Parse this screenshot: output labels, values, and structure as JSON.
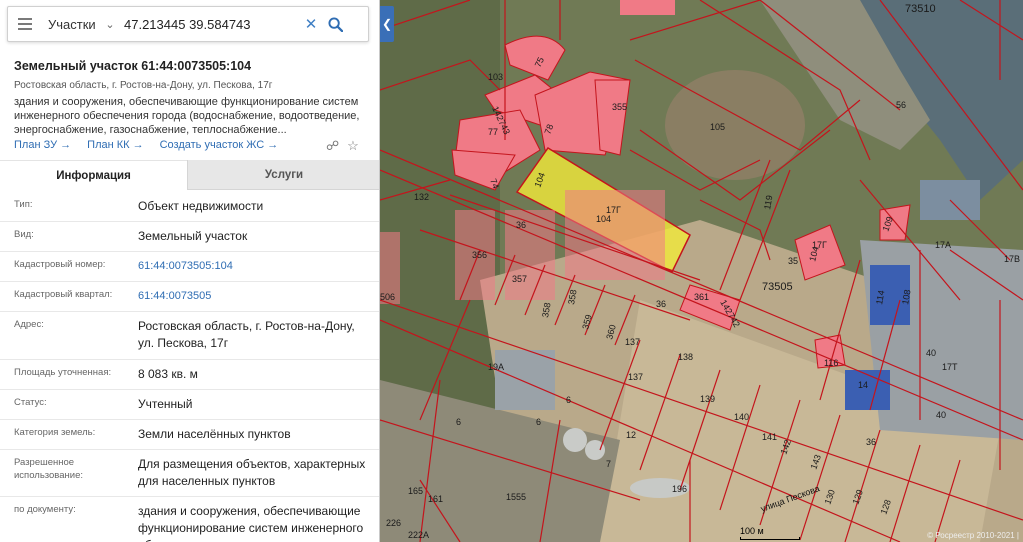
{
  "search": {
    "type_label": "Участки",
    "query": "47.213445 39.584743"
  },
  "object": {
    "title": "Земельный участок 61:44:0073505:104",
    "address_short": "Ростовская область, г. Ростов-на-Дону, ул. Пескова, 17г",
    "description": "здания и сооружения, обеспечивающие функционирование систем инженерного обеспечения города (водоснабжение, водоотведение, энергоснабжение, газоснабжение, теплоснабжение..."
  },
  "actions": [
    {
      "label": "План ЗУ"
    },
    {
      "label": "План КК"
    },
    {
      "label": "Создать участок ЖС"
    }
  ],
  "tabs": {
    "info": "Информация",
    "services": "Услуги"
  },
  "properties": [
    {
      "label": "Тип:",
      "value": "Объект недвижимости",
      "link": false
    },
    {
      "label": "Вид:",
      "value": "Земельный участок",
      "link": false
    },
    {
      "label": "Кадастровый номер:",
      "value": "61:44:0073505:104",
      "link": true
    },
    {
      "label": "Кадастровый квартал:",
      "value": "61:44:0073505",
      "link": true
    },
    {
      "label": "Адрес:",
      "value": "Ростовская область, г. Ростов-на-Дону, ул. Пескова, 17г",
      "link": false
    },
    {
      "label": "Площадь уточненная:",
      "value": "8 083 кв. м",
      "link": false
    },
    {
      "label": "Статус:",
      "value": "Учтенный",
      "link": false
    },
    {
      "label": "Категория земель:",
      "value": "Земли населённых пунктов",
      "link": false
    },
    {
      "label": "Разрешенное использование:",
      "value": "Для размещения объектов, характерных для населенных пунктов",
      "link": false
    },
    {
      "label": "по документу:",
      "value": "здания и сооружения, обеспечивающие функционирование систем инженерного обеспечения",
      "link": false
    }
  ],
  "map": {
    "quarters": [
      "73510",
      "73505"
    ],
    "parcel_labels": [
      "103",
      "75",
      "142743",
      "77",
      "78",
      "355",
      "74",
      "104",
      "104",
      "17Г",
      "132",
      "36",
      "356",
      "357",
      "358",
      "358",
      "359",
      "360",
      "36",
      "361",
      "142742",
      "105",
      "119",
      "35",
      "17Г",
      "104",
      "109",
      "17А",
      "114",
      "108",
      "56",
      "6",
      "137",
      "138",
      "137",
      "139",
      "140",
      "141",
      "142",
      "143",
      "130",
      "129",
      "128",
      "36",
      "40",
      "14",
      "116",
      "17Т",
      "40",
      "19А",
      "6",
      "6",
      "12",
      "7",
      "196",
      "165",
      "1555",
      "161",
      "226",
      "222А",
      "17В",
      "506"
    ],
    "street_label": "улица Пескова",
    "scale_label": "100 м",
    "copyright": "© Росреестр 2010-2021 |"
  },
  "colors": {
    "accent": "#2f6db3",
    "parcel_fill": "#f07a86",
    "selected_parcel": "#f2ea3a",
    "boundary": "#c4141c"
  }
}
